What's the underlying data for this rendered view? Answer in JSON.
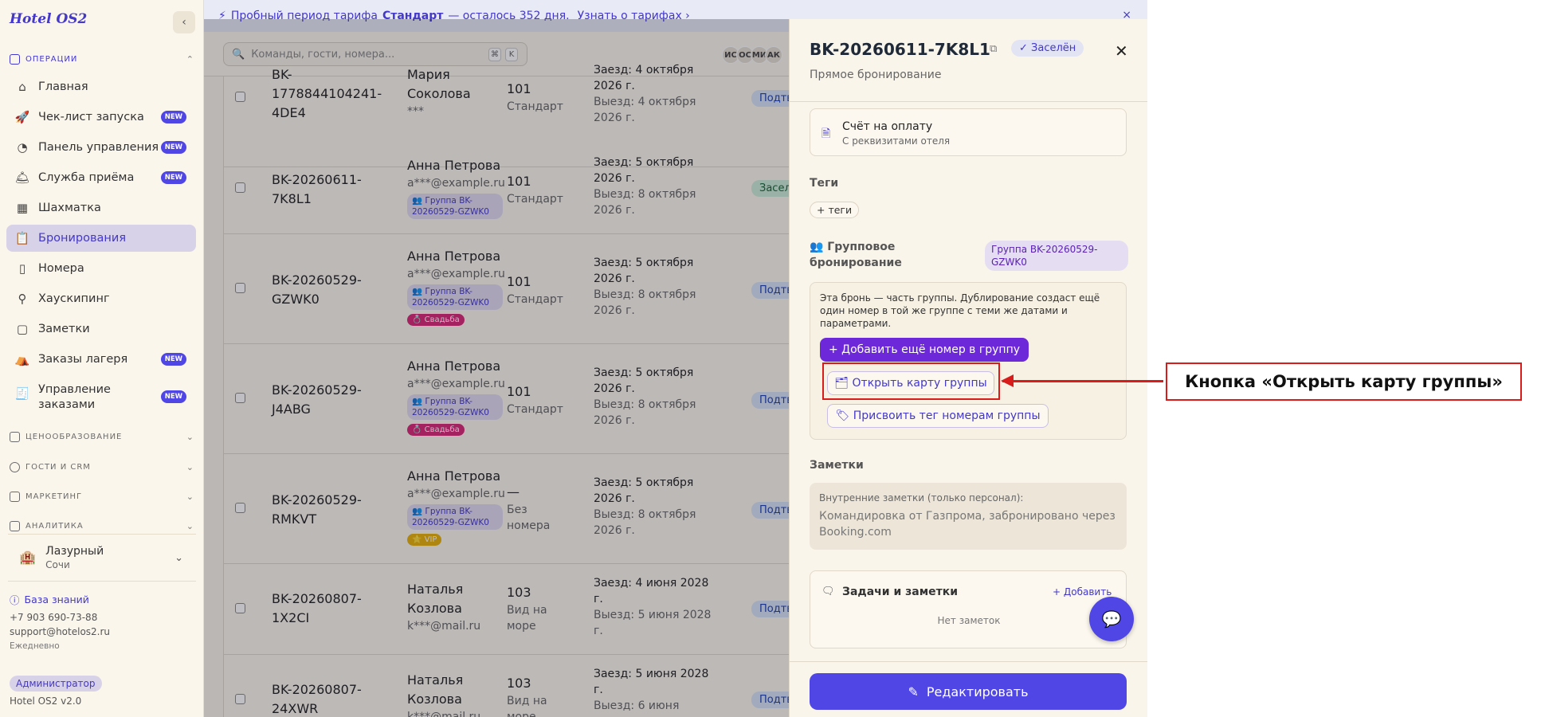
{
  "app": {
    "logo": "Hotel OS2",
    "collapse_icon": "‹"
  },
  "sidebar": {
    "sections": [
      {
        "label": "ОПЕРАЦИИ",
        "expanded": true
      },
      {
        "label": "ЦЕНООБРАЗОВАНИЕ"
      },
      {
        "label": "ГОСТИ И CRM"
      },
      {
        "label": "МАРКЕТИНГ"
      },
      {
        "label": "АНАЛИТИКА"
      }
    ],
    "items": [
      {
        "label": "Главная",
        "icon": "home-icon"
      },
      {
        "label": "Чек-лист запуска",
        "icon": "rocket-icon",
        "badge": "NEW"
      },
      {
        "label": "Панель управления",
        "icon": "gauge-icon",
        "badge": "NEW"
      },
      {
        "label": "Служба приёма",
        "icon": "bell-icon",
        "badge": "NEW"
      },
      {
        "label": "Шахматка",
        "icon": "grid-icon"
      },
      {
        "label": "Бронирования",
        "icon": "clipboard-icon",
        "active": true
      },
      {
        "label": "Номера",
        "icon": "door-icon"
      },
      {
        "label": "Хаускипинг",
        "icon": "broom-icon"
      },
      {
        "label": "Заметки",
        "icon": "note-icon"
      },
      {
        "label": "Заказы лагеря",
        "icon": "tent-icon",
        "badge": "NEW"
      },
      {
        "label": "Управление",
        "label2": "заказами",
        "icon": "receipt-icon",
        "badge": "NEW"
      }
    ],
    "hotel": {
      "name": "Лазурный",
      "city": "Сочи"
    },
    "knowledge_base": "База знаний",
    "phone": "+7 903 690-73-88",
    "email": "support@hotelos2.ru",
    "hours": "Ежедневно",
    "role": "Администратор",
    "version": "Hotel OS2 v2.0"
  },
  "trial": {
    "text1": "Пробный период тарифа",
    "plan": "Стандарт",
    "text2": "— осталось 352 дня.",
    "link": "Узнать о тарифах ›",
    "close": "×"
  },
  "search": {
    "placeholder": "Команды, гости, номера...",
    "key1": "⌘",
    "key2": "K"
  },
  "avatars": [
    "ИС",
    "ОС",
    "МИ",
    "АК"
  ],
  "bookings": [
    {
      "id": "BK-\n1778844104241-\n4DE4",
      "guest": "Мария Соколова",
      "contact": "***",
      "room": "101",
      "room_type": "Стандарт",
      "checkin": "Заезд: 4 октября 2026 г.",
      "checkout": "Выезд: 4 октября 2026 г.",
      "status": "Подтв",
      "status_kind": "conf"
    },
    {
      "id": "BK-20260611-\n7K8L1",
      "guest": "Анна Петрова",
      "contact": "a***@example.ru",
      "group": "👥 Группа BK-20260529-GZWK0",
      "room": "101",
      "room_type": "Стандарт",
      "checkin": "Заезд: 5 октября 2026 г.",
      "checkout": "Выезд: 8 октября 2026 г.",
      "status": "Заселе",
      "status_kind": "in"
    },
    {
      "id": "BK-20260529-\nGZWK0",
      "guest": "Анна Петрова",
      "contact": "a***@example.ru",
      "group": "👥 Группа BK-20260529-GZWK0",
      "tag": "💍 Свадьба",
      "room": "101",
      "room_type": "Стандарт",
      "checkin": "Заезд: 5 октября 2026 г.",
      "checkout": "Выезд: 8 октября 2026 г.",
      "status": "Подтв",
      "status_kind": "conf"
    },
    {
      "id": "BK-20260529-\nJ4ABG",
      "guest": "Анна Петрова",
      "contact": "a***@example.ru",
      "group": "👥 Группа BK-20260529-GZWK0",
      "tag": "💍 Свадьба",
      "room": "101",
      "room_type": "Стандарт",
      "checkin": "Заезд: 5 октября 2026 г.",
      "checkout": "Выезд: 8 октября 2026 г.",
      "status": "Подтв",
      "status_kind": "conf"
    },
    {
      "id": "BK-20260529-\nRMKVT",
      "guest": "Анна Петрова",
      "contact": "a***@example.ru",
      "group": "👥 Группа BK-20260529-GZWK0",
      "vip": "⭐ VIP",
      "room": "—",
      "room_type": "Без номера",
      "checkin": "Заезд: 5 октября 2026 г.",
      "checkout": "Выезд: 8 октября 2026 г.",
      "status": "Подтв",
      "status_kind": "conf"
    },
    {
      "id": "BK-20260807-\n1X2CI",
      "guest": "Наталья Козлова",
      "contact": "k***@mail.ru",
      "room": "103",
      "room_type": "Вид на море",
      "checkin": "Заезд: 4 июня 2028 г.",
      "checkout": "Выезд: 5 июня 2028 г.",
      "status": "Подтв",
      "status_kind": "conf"
    },
    {
      "id": "BK-20260807-\n24XWR",
      "guest": "Наталья Козлова",
      "contact": "k***@mail.ru",
      "room": "103",
      "room_type": "Вид на море",
      "checkin": "Заезд: 5 июня 2028 г.",
      "checkout": "Выезд: 6 июня",
      "status": "Подтв",
      "status_kind": "conf"
    }
  ],
  "drawer": {
    "title": "BK-20260611-7K8L1",
    "status": "Заселён",
    "subtitle": "Прямое бронирование",
    "close": "✕",
    "invoice_title": "Счёт на оплату",
    "invoice_sub": "С реквизитами отеля",
    "tags_label": "Теги",
    "add_tag": "+ теги",
    "group_label": "👥 Групповое бронирование",
    "group_pill": "Группа BK-20260529-GZWK0",
    "group_text": "Эта бронь — часть группы. Дублирование создаст ещё один номер в той же группе с теми же датами и параметрами.",
    "add_room_btn": "+ Добавить ещё номер в группу",
    "open_group_btn": "🗂 Открыть карту группы",
    "assign_tag_btn": "🏷 Присвоить тег номерам группы",
    "notes_label": "Заметки",
    "notes_hint": "Внутренние заметки (только персонал):",
    "notes_text": "Командировка от Газпрома, забронировано через Booking.com",
    "tasks_title": "Задачи и заметки",
    "tasks_add": "+ Добавить",
    "tasks_empty": "Нет заметок",
    "edit_btn": "Редактировать"
  },
  "annotation": {
    "callout": "Кнопка «Открыть карту группы»"
  },
  "colors": {
    "accent": "#4f46e5",
    "highlight": "#d81b1b"
  }
}
